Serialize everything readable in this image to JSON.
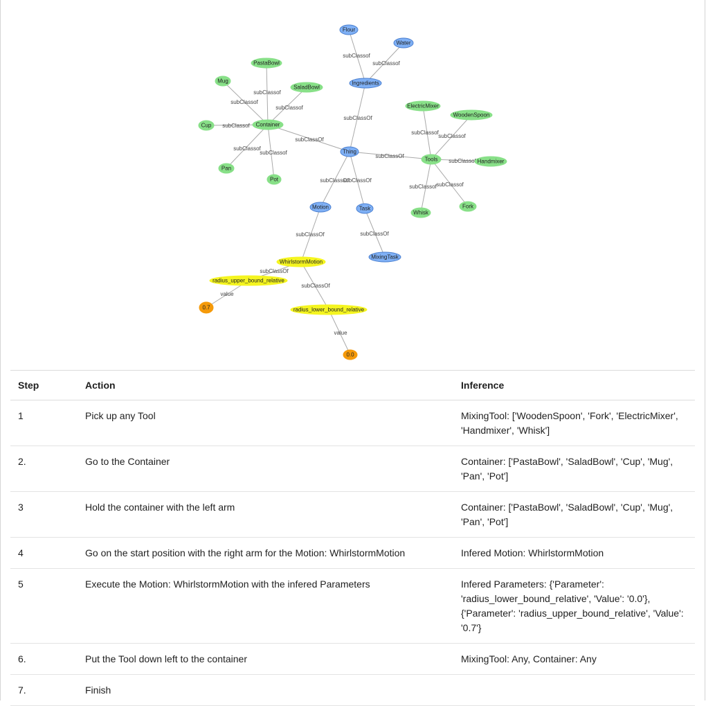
{
  "graph": {
    "nodes": [
      {
        "id": "Flour",
        "label": "Flour",
        "color": "#7fb0f5",
        "stroke": "#4a7fd0"
      },
      {
        "id": "Water",
        "label": "Water",
        "color": "#7fb0f5",
        "stroke": "#4a7fd0"
      },
      {
        "id": "Ingredients",
        "label": "Ingredients",
        "color": "#7fb0f5",
        "stroke": "#4a7fd0"
      },
      {
        "id": "PastaBowl",
        "label": "PastaBowl",
        "color": "#88e088",
        "stroke": "#88e088"
      },
      {
        "id": "Mug",
        "label": "Mug",
        "color": "#88e088",
        "stroke": "#88e088"
      },
      {
        "id": "SaladBowl",
        "label": "SaladBowl",
        "color": "#88e088",
        "stroke": "#88e088"
      },
      {
        "id": "Cup",
        "label": "Cup",
        "color": "#88e088",
        "stroke": "#88e088"
      },
      {
        "id": "Container",
        "label": "Container",
        "color": "#88e088",
        "stroke": "#88e088"
      },
      {
        "id": "Pan",
        "label": "Pan",
        "color": "#88e088",
        "stroke": "#88e088"
      },
      {
        "id": "Pot",
        "label": "Pot",
        "color": "#88e088",
        "stroke": "#88e088"
      },
      {
        "id": "Thing",
        "label": "Thing",
        "color": "#7fb0f5",
        "stroke": "#4a7fd0"
      },
      {
        "id": "ElectricMixer",
        "label": "ElectricMixer",
        "color": "#88e088",
        "stroke": "#88e088"
      },
      {
        "id": "WoodenSpoon",
        "label": "WoodenSpoon",
        "color": "#88e088",
        "stroke": "#88e088"
      },
      {
        "id": "Tools",
        "label": "Tools",
        "color": "#88e088",
        "stroke": "#88e088"
      },
      {
        "id": "Handmixer",
        "label": "Handmixer",
        "color": "#88e088",
        "stroke": "#88e088"
      },
      {
        "id": "Whisk",
        "label": "Whisk",
        "color": "#88e088",
        "stroke": "#88e088"
      },
      {
        "id": "Fork",
        "label": "Fork",
        "color": "#88e088",
        "stroke": "#88e088"
      },
      {
        "id": "Motion",
        "label": "Motion",
        "color": "#7fb0f5",
        "stroke": "#4a7fd0"
      },
      {
        "id": "Task",
        "label": "Task",
        "color": "#7fb0f5",
        "stroke": "#4a7fd0"
      },
      {
        "id": "MixingTask",
        "label": "MixingTask",
        "color": "#7fb0f5",
        "stroke": "#4a7fd0"
      },
      {
        "id": "WhirlstormMotion",
        "label": "WhirlstormMotion",
        "color": "#f5f520",
        "stroke": "#f5f520"
      },
      {
        "id": "radius_upper_bound_relative",
        "label": "radius_upper_bound_relative",
        "color": "#f5f520",
        "stroke": "#f5f520"
      },
      {
        "id": "radius_lower_bound_relative",
        "label": "radius_lower_bound_relative",
        "color": "#f5f520",
        "stroke": "#f5f520"
      },
      {
        "id": "v07",
        "label": "0.7",
        "color": "#f59a0a",
        "stroke": "#f59a0a"
      },
      {
        "id": "v00",
        "label": "0.0",
        "color": "#f59a0a",
        "stroke": "#f59a0a"
      }
    ],
    "edges": [
      {
        "from": "Flour",
        "to": "Ingredients",
        "label": "subClassof"
      },
      {
        "from": "Water",
        "to": "Ingredients",
        "label": "subClassof"
      },
      {
        "from": "Ingredients",
        "to": "Thing",
        "label": "subClassOf"
      },
      {
        "from": "PastaBowl",
        "to": "Container",
        "label": "subClassof"
      },
      {
        "from": "Mug",
        "to": "Container",
        "label": "subClassof"
      },
      {
        "from": "SaladBowl",
        "to": "Container",
        "label": "subClassof"
      },
      {
        "from": "Cup",
        "to": "Container",
        "label": "subClassof"
      },
      {
        "from": "Pan",
        "to": "Container",
        "label": "subClassof"
      },
      {
        "from": "Pot",
        "to": "Container",
        "label": "subClassof"
      },
      {
        "from": "Container",
        "to": "Thing",
        "label": "subClassOf"
      },
      {
        "from": "Tools",
        "to": "Thing",
        "label": "subClassOf"
      },
      {
        "from": "ElectricMixer",
        "to": "Tools",
        "label": "subClassof"
      },
      {
        "from": "WoodenSpoon",
        "to": "Tools",
        "label": "subClassof"
      },
      {
        "from": "Handmixer",
        "to": "Tools",
        "label": "subClassof"
      },
      {
        "from": "Whisk",
        "to": "Tools",
        "label": "subClassof"
      },
      {
        "from": "Fork",
        "to": "Tools",
        "label": "subClassof"
      },
      {
        "from": "Motion",
        "to": "Thing",
        "label": "subClassOf"
      },
      {
        "from": "Task",
        "to": "Thing",
        "label": "subClassOf"
      },
      {
        "from": "MixingTask",
        "to": "Task",
        "label": "subClassOf"
      },
      {
        "from": "WhirlstormMotion",
        "to": "Motion",
        "label": "subClassOf"
      },
      {
        "from": "radius_upper_bound_relative",
        "to": "WhirlstormMotion",
        "label": "subClassOf"
      },
      {
        "from": "radius_lower_bound_relative",
        "to": "WhirlstormMotion",
        "label": "subClassOf"
      },
      {
        "from": "v07",
        "to": "radius_upper_bound_relative",
        "label": "value"
      },
      {
        "from": "v00",
        "to": "radius_lower_bound_relative",
        "label": "value"
      }
    ]
  },
  "table": {
    "headers": {
      "step": "Step",
      "action": "Action",
      "inference": "Inference"
    },
    "rows": [
      {
        "step": "1",
        "action": "Pick up any Tool",
        "inference": "MixingTool: ['WoodenSpoon', 'Fork', 'ElectricMixer', 'Handmixer', 'Whisk']"
      },
      {
        "step": "2.",
        "action": "Go to the Container",
        "inference": "Container: ['PastaBowl', 'SaladBowl', 'Cup', 'Mug', 'Pan', 'Pot']"
      },
      {
        "step": "3",
        "action": "Hold the container with the left arm",
        "inference": "Container: ['PastaBowl', 'SaladBowl', 'Cup', 'Mug', 'Pan', 'Pot']"
      },
      {
        "step": "4",
        "action": "Go on the start position with the right arm for the Motion: WhirlstormMotion",
        "inference": "Infered Motion: WhirlstormMotion"
      },
      {
        "step": "5",
        "action": "Execute the Motion: WhirlstormMotion with the infered Parameters",
        "inference": "Infered Parameters: {'Parameter': 'radius_lower_bound_relative', 'Value': '0.0'}, {'Parameter': 'radius_upper_bound_relative', 'Value': '0.7'}"
      },
      {
        "step": "6.",
        "action": "Put the Tool down left to the container",
        "inference": "MixingTool: Any, Container: Any"
      },
      {
        "step": "7.",
        "action": "Finish",
        "inference": ""
      }
    ]
  }
}
